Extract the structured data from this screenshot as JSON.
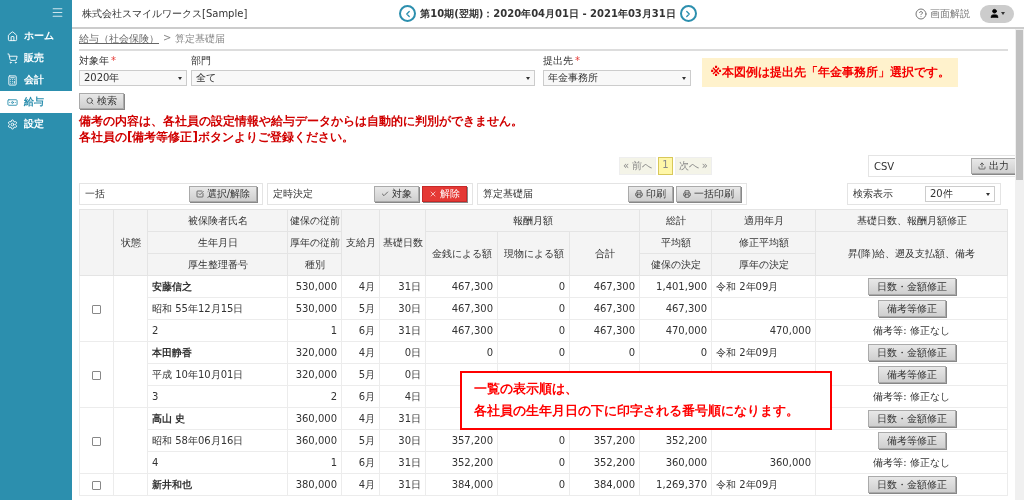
{
  "sidebar": {
    "items": [
      {
        "label": "ホーム",
        "selected": false
      },
      {
        "label": "販売",
        "selected": false
      },
      {
        "label": "会計",
        "selected": false
      },
      {
        "label": "給与",
        "selected": true
      },
      {
        "label": "設定",
        "selected": false
      }
    ]
  },
  "header": {
    "company": "株式会社スマイルワークス[Sample]",
    "period": "第10期(翌期)：2020年04月01日 - 2021年03月31日",
    "help": "画面解説"
  },
  "breadcrumb": {
    "parent": "給与（社会保険）",
    "separator": ">",
    "current": "算定基礎届"
  },
  "filters": [
    {
      "label": "対象年",
      "required": true,
      "value": "2020年"
    },
    {
      "label": "部門",
      "required": false,
      "value": "全て"
    },
    {
      "label": "提出先",
      "required": true,
      "value": "年金事務所"
    }
  ],
  "required_mark": "*",
  "notice": "※本図例は提出先「年金事務所」選択です。",
  "search_button": "検索",
  "warnings": [
    "備考の内容は、各社員の設定情報や給与データからは自動的に判別ができません。",
    "各社員の[備考等修正]ボタンよりご登録ください。"
  ],
  "pagination": {
    "prev": "« 前へ",
    "pages": [
      {
        "label": "1",
        "selected": true
      }
    ],
    "next": "次へ »"
  },
  "csv": {
    "label": "CSV",
    "button": "出力"
  },
  "bulk": {
    "label": "一括",
    "button": "選択/解除"
  },
  "regular": {
    "label": "定時決定",
    "target_button": "対象",
    "release_button": "解除"
  },
  "form": {
    "label": "算定基礎届",
    "print_button": "印刷",
    "bulk_print_button": "一括印刷"
  },
  "display": {
    "label": "検索表示",
    "value": "20件"
  },
  "table": {
    "header": {
      "status": "状態",
      "name": [
        "被保険者氏名",
        "生年月日",
        "厚生整理番号"
      ],
      "prior": [
        "健保の従前",
        "厚年の従前",
        "種別"
      ],
      "month": "支給月",
      "days": "基礎日数",
      "remuneration": "報酬月額",
      "cash": "金銭による額",
      "in_kind": "現物による額",
      "total": "合計",
      "grand": [
        "総計",
        "平均額",
        "健保の決定"
      ],
      "applied": [
        "適用年月",
        "修正平均額",
        "厚年の決定"
      ],
      "correction": [
        "基礎日数、報酬月額修正",
        "昇(降)給、遡及支払額、備考"
      ]
    },
    "rows": [
      {
        "checked": false,
        "lines": [
          {
            "cells": [
              "安藤信之",
              "530,000",
              "4月",
              "31日",
              "467,300",
              "0",
              "467,300",
              "1,401,900",
              "令和 2年09月"
            ],
            "action": {
              "kind": "button",
              "label": "日数・金額修正"
            }
          },
          {
            "cells": [
              "昭和 55年12月15日",
              "530,000",
              "5月",
              "30日",
              "467,300",
              "0",
              "467,300",
              "467,300",
              null
            ],
            "action": {
              "kind": "button",
              "label": "備考等修正"
            }
          },
          {
            "cells": [
              "2",
              "1",
              "6月",
              "31日",
              "467,300",
              "0",
              "467,300",
              "470,000",
              "470,000"
            ],
            "action": {
              "kind": "text",
              "label": "備考等: 修正なし"
            }
          }
        ]
      },
      {
        "checked": false,
        "lines": [
          {
            "cells": [
              "本田静香",
              "320,000",
              "4月",
              "0日",
              "0",
              "0",
              "0",
              "0",
              "令和 2年09月"
            ],
            "action": {
              "kind": "button",
              "label": "日数・金額修正"
            }
          },
          {
            "cells": [
              "平成 10年10月01日",
              "320,000",
              "5月",
              "0日",
              null,
              null,
              null,
              null,
              null
            ],
            "action": {
              "kind": "button",
              "label": "備考等修正"
            }
          },
          {
            "cells": [
              "3",
              "2",
              "6月",
              "4日",
              null,
              null,
              null,
              null,
              null
            ],
            "action": {
              "kind": "text",
              "label": "備考等: 修正なし"
            }
          }
        ]
      },
      {
        "checked": false,
        "lines": [
          {
            "cells": [
              "高山 史",
              "360,000",
              "4月",
              "31日",
              null,
              null,
              null,
              null,
              null
            ],
            "action": {
              "kind": "button",
              "label": "日数・金額修正"
            }
          },
          {
            "cells": [
              "昭和 58年06月16日",
              "360,000",
              "5月",
              "30日",
              "357,200",
              "0",
              "357,200",
              "352,200",
              null
            ],
            "action": {
              "kind": "button",
              "label": "備考等修正"
            }
          },
          {
            "cells": [
              "4",
              "1",
              "6月",
              "31日",
              "352,200",
              "0",
              "352,200",
              "360,000",
              "360,000"
            ],
            "action": {
              "kind": "text",
              "label": "備考等: 修正なし"
            }
          }
        ]
      },
      {
        "checked": false,
        "lines": [
          {
            "cells": [
              "新井和也",
              "380,000",
              "4月",
              "31日",
              "384,000",
              "0",
              "384,000",
              "1,269,370",
              "令和 2年09月"
            ],
            "action": {
              "kind": "button",
              "label": "日数・金額修正"
            }
          }
        ]
      }
    ]
  },
  "callout": [
    "一覧の表示順は、",
    "各社員の生年月日の下に印字される番号順になります。"
  ]
}
